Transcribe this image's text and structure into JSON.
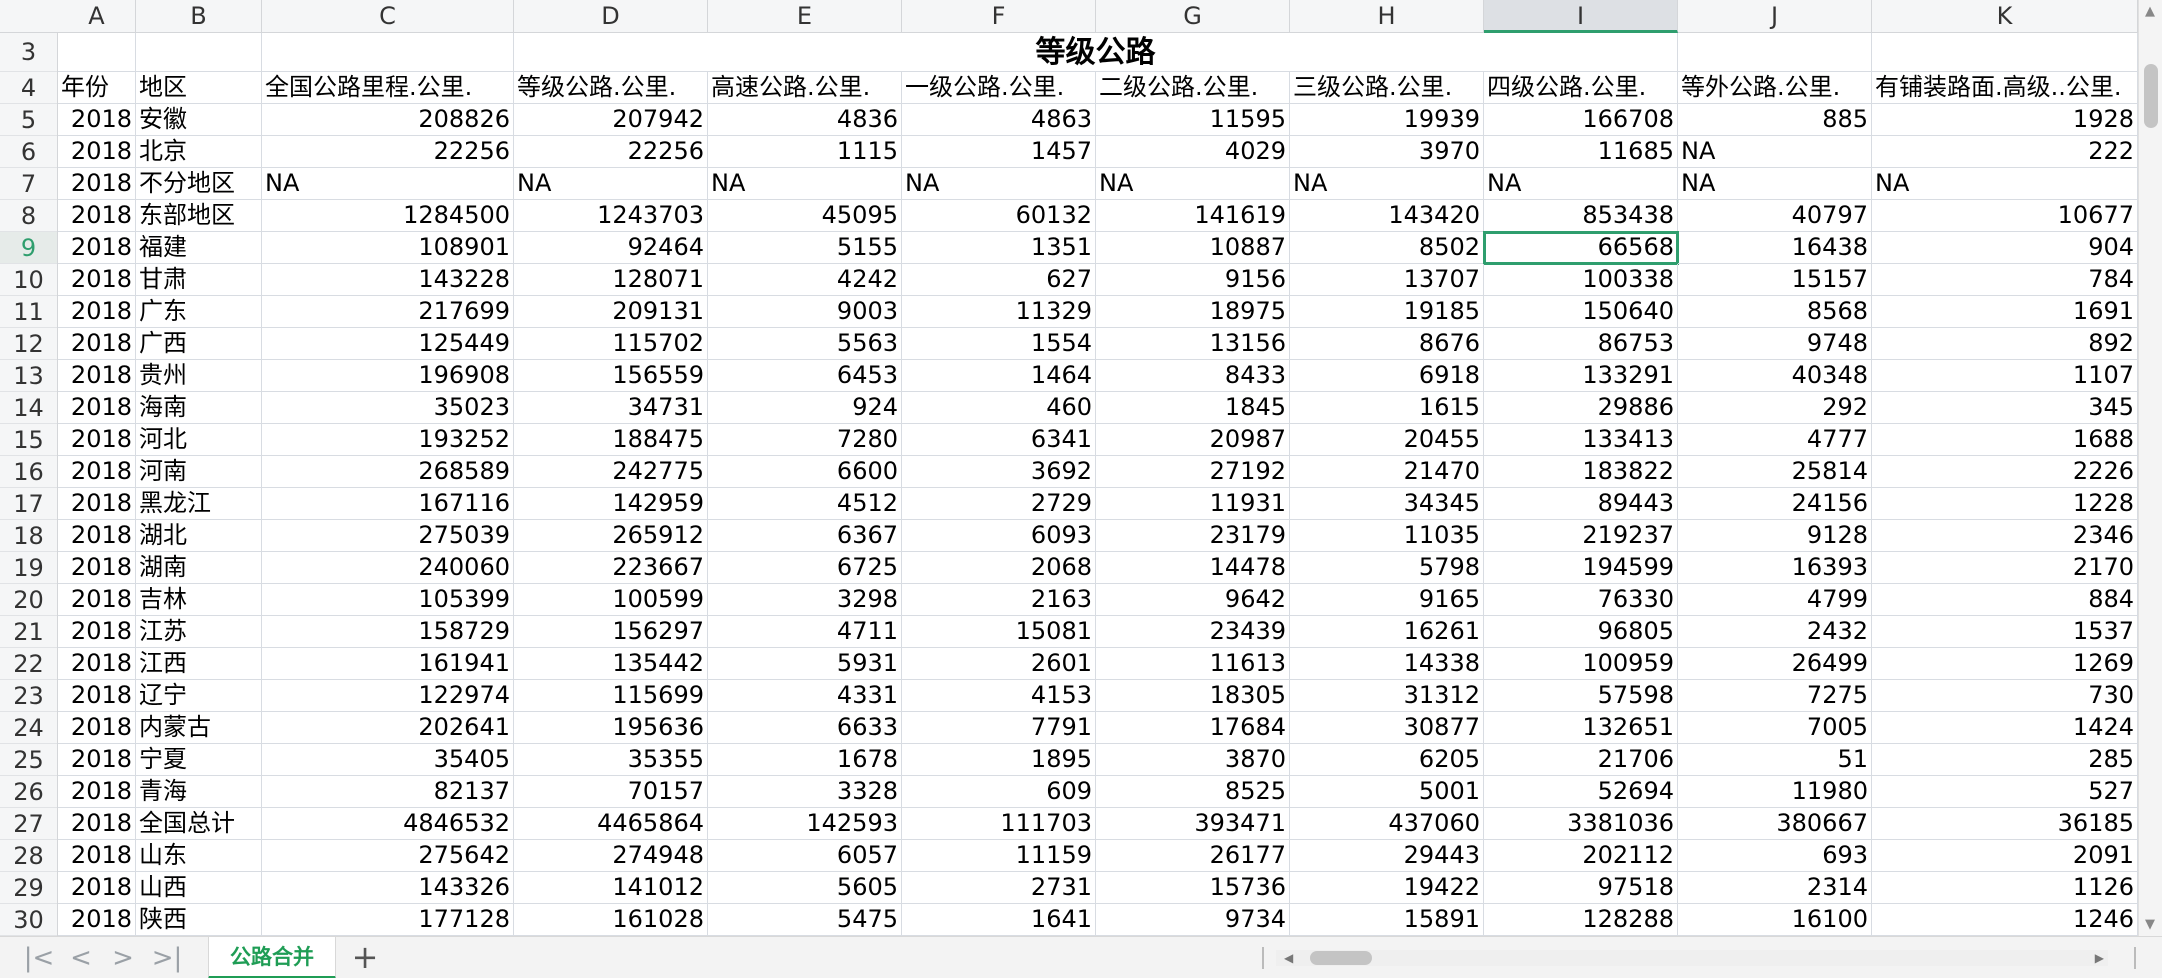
{
  "columns": [
    "A",
    "B",
    "C",
    "D",
    "E",
    "F",
    "G",
    "H",
    "I",
    "J",
    "K"
  ],
  "selected_column": "I",
  "title_row": {
    "row": "3",
    "title": "等级公路"
  },
  "header_row": {
    "row": "4",
    "cells": [
      "年份",
      "地区",
      "全国公路里程.公里.",
      "等级公路.公里.",
      "高速公路.公里.",
      "一级公路.公里.",
      "二级公路.公里.",
      "三级公路.公里.",
      "四级公路.公里.",
      "等外公路.公里.",
      "有铺装路面.高级..公里."
    ]
  },
  "selected_row": "9",
  "active_cell": {
    "row": "9",
    "col": "I"
  },
  "rows": [
    {
      "n": "5",
      "cells": [
        "2018",
        "安徽",
        "208826",
        "207942",
        "4836",
        "4863",
        "11595",
        "19939",
        "166708",
        "885",
        "1928"
      ]
    },
    {
      "n": "6",
      "cells": [
        "2018",
        "北京",
        "22256",
        "22256",
        "1115",
        "1457",
        "4029",
        "3970",
        "11685",
        "NA",
        "222"
      ]
    },
    {
      "n": "7",
      "cells": [
        "2018",
        "不分地区",
        "NA",
        "NA",
        "NA",
        "NA",
        "NA",
        "NA",
        "NA",
        "NA",
        "NA"
      ]
    },
    {
      "n": "8",
      "cells": [
        "2018",
        "东部地区",
        "1284500",
        "1243703",
        "45095",
        "60132",
        "141619",
        "143420",
        "853438",
        "40797",
        "10677"
      ]
    },
    {
      "n": "9",
      "cells": [
        "2018",
        "福建",
        "108901",
        "92464",
        "5155",
        "1351",
        "10887",
        "8502",
        "66568",
        "16438",
        "904"
      ]
    },
    {
      "n": "10",
      "cells": [
        "2018",
        "甘肃",
        "143228",
        "128071",
        "4242",
        "627",
        "9156",
        "13707",
        "100338",
        "15157",
        "784"
      ]
    },
    {
      "n": "11",
      "cells": [
        "2018",
        "广东",
        "217699",
        "209131",
        "9003",
        "11329",
        "18975",
        "19185",
        "150640",
        "8568",
        "1691"
      ]
    },
    {
      "n": "12",
      "cells": [
        "2018",
        "广西",
        "125449",
        "115702",
        "5563",
        "1554",
        "13156",
        "8676",
        "86753",
        "9748",
        "892"
      ]
    },
    {
      "n": "13",
      "cells": [
        "2018",
        "贵州",
        "196908",
        "156559",
        "6453",
        "1464",
        "8433",
        "6918",
        "133291",
        "40348",
        "1107"
      ]
    },
    {
      "n": "14",
      "cells": [
        "2018",
        "海南",
        "35023",
        "34731",
        "924",
        "460",
        "1845",
        "1615",
        "29886",
        "292",
        "345"
      ]
    },
    {
      "n": "15",
      "cells": [
        "2018",
        "河北",
        "193252",
        "188475",
        "7280",
        "6341",
        "20987",
        "20455",
        "133413",
        "4777",
        "1688"
      ]
    },
    {
      "n": "16",
      "cells": [
        "2018",
        "河南",
        "268589",
        "242775",
        "6600",
        "3692",
        "27192",
        "21470",
        "183822",
        "25814",
        "2226"
      ]
    },
    {
      "n": "17",
      "cells": [
        "2018",
        "黑龙江",
        "167116",
        "142959",
        "4512",
        "2729",
        "11931",
        "34345",
        "89443",
        "24156",
        "1228"
      ]
    },
    {
      "n": "18",
      "cells": [
        "2018",
        "湖北",
        "275039",
        "265912",
        "6367",
        "6093",
        "23179",
        "11035",
        "219237",
        "9128",
        "2346"
      ]
    },
    {
      "n": "19",
      "cells": [
        "2018",
        "湖南",
        "240060",
        "223667",
        "6725",
        "2068",
        "14478",
        "5798",
        "194599",
        "16393",
        "2170"
      ]
    },
    {
      "n": "20",
      "cells": [
        "2018",
        "吉林",
        "105399",
        "100599",
        "3298",
        "2163",
        "9642",
        "9165",
        "76330",
        "4799",
        "884"
      ]
    },
    {
      "n": "21",
      "cells": [
        "2018",
        "江苏",
        "158729",
        "156297",
        "4711",
        "15081",
        "23439",
        "16261",
        "96805",
        "2432",
        "1537"
      ]
    },
    {
      "n": "22",
      "cells": [
        "2018",
        "江西",
        "161941",
        "135442",
        "5931",
        "2601",
        "11613",
        "14338",
        "100959",
        "26499",
        "1269"
      ]
    },
    {
      "n": "23",
      "cells": [
        "2018",
        "辽宁",
        "122974",
        "115699",
        "4331",
        "4153",
        "18305",
        "31312",
        "57598",
        "7275",
        "730"
      ]
    },
    {
      "n": "24",
      "cells": [
        "2018",
        "内蒙古",
        "202641",
        "195636",
        "6633",
        "7791",
        "17684",
        "30877",
        "132651",
        "7005",
        "1424"
      ]
    },
    {
      "n": "25",
      "cells": [
        "2018",
        "宁夏",
        "35405",
        "35355",
        "1678",
        "1895",
        "3870",
        "6205",
        "21706",
        "51",
        "285"
      ]
    },
    {
      "n": "26",
      "cells": [
        "2018",
        "青海",
        "82137",
        "70157",
        "3328",
        "609",
        "8525",
        "5001",
        "52694",
        "11980",
        "527"
      ]
    },
    {
      "n": "27",
      "cells": [
        "2018",
        "全国总计",
        "4846532",
        "4465864",
        "142593",
        "111703",
        "393471",
        "437060",
        "3381036",
        "380667",
        "36185"
      ]
    },
    {
      "n": "28",
      "cells": [
        "2018",
        "山东",
        "275642",
        "274948",
        "6057",
        "11159",
        "26177",
        "29443",
        "202112",
        "693",
        "2091"
      ]
    },
    {
      "n": "29",
      "cells": [
        "2018",
        "山西",
        "143326",
        "141012",
        "5605",
        "2731",
        "15736",
        "19422",
        "97518",
        "2314",
        "1126"
      ]
    },
    {
      "n": "30",
      "cells": [
        "2018",
        "陕西",
        "177128",
        "161028",
        "5475",
        "1641",
        "9734",
        "15891",
        "128288",
        "16100",
        "1246"
      ]
    }
  ],
  "sheet_tabs": [
    {
      "label": "公路合并",
      "active": true
    }
  ],
  "nav": {
    "first": "|<",
    "prev": "<",
    "next": ">",
    "last": ">|",
    "add": "+"
  },
  "colors": {
    "accent": "#1f9d55",
    "selection": "#2f9e6e"
  }
}
